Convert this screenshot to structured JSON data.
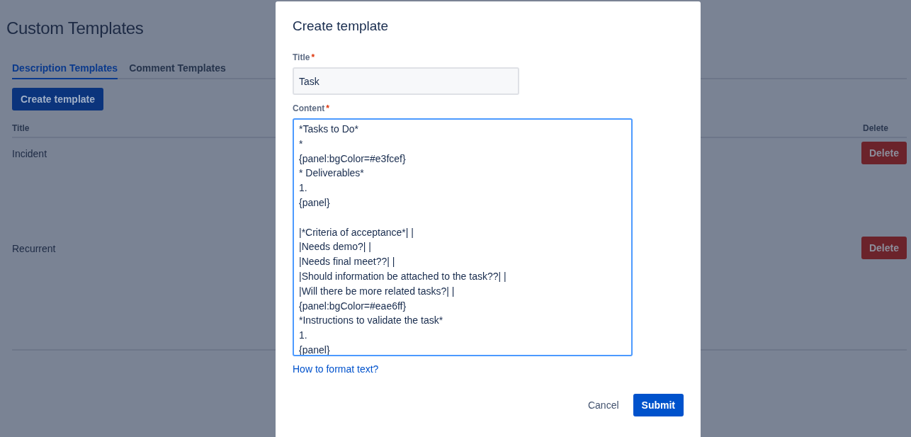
{
  "page": {
    "title": "Custom Templates",
    "tabs": [
      {
        "label": "Description Templates",
        "selected": true
      },
      {
        "label": "Comment Templates",
        "selected": false
      }
    ],
    "create_button": "Create template",
    "table": {
      "columns": [
        "Title",
        "Delete"
      ],
      "rows": [
        {
          "title": "Incident",
          "action": "Delete"
        },
        {
          "title": "Recurrent",
          "action": "Delete"
        }
      ]
    }
  },
  "dialog": {
    "title": "Create template",
    "fields": [
      {
        "kind": "input",
        "label": "Title",
        "required_mark": "*",
        "value": "Task"
      },
      {
        "kind": "textarea",
        "label": "Content",
        "required_mark": "*",
        "focused": true,
        "value": "*Tasks to Do*\n*\n{panel:bgColor=#e3fcef}\n* Deliverables*\n1.\n{panel}\n\n|*Criteria of acceptance*| |\n|Needs demo?| |\n|Needs final meet??| |\n|Should information be attached to the task??| |\n|Will there be more related tasks?| |\n{panel:bgColor=#eae6ff}\n*Instructions to validate the task*\n1.\n{panel}"
      }
    ],
    "help_link": "How to format text?",
    "buttons": [
      {
        "kind": "subtle",
        "label": "Cancel"
      },
      {
        "kind": "primary",
        "label": "Submit"
      }
    ]
  }
}
